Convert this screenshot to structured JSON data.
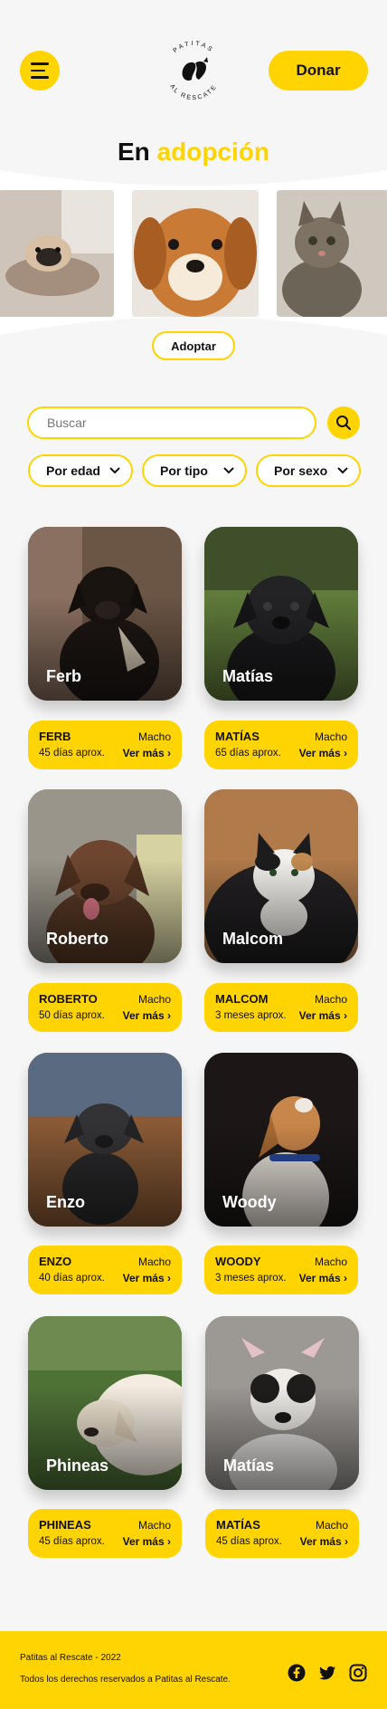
{
  "header": {
    "brand_top": "PATITAS",
    "brand_bottom": "AL RESCATE",
    "donate_label": "Donar"
  },
  "hero": {
    "title_plain": "En",
    "title_accent": "adopción",
    "adopt_label": "Adoptar"
  },
  "search": {
    "placeholder": "Buscar"
  },
  "filters": [
    {
      "label": "Por edad"
    },
    {
      "label": "Por tipo"
    },
    {
      "label": "Por sexo"
    }
  ],
  "pets": [
    {
      "photo_name": "Ferb",
      "name": "FERB",
      "sex": "Macho",
      "age": "45 días aprox.",
      "more": "Ver más"
    },
    {
      "photo_name": "Matías",
      "name": "MATÍAS",
      "sex": "Macho",
      "age": "65 días aprox.",
      "more": "Ver más"
    },
    {
      "photo_name": "Roberto",
      "name": "ROBERTO",
      "sex": "Macho",
      "age": "50 días aprox.",
      "more": "Ver más"
    },
    {
      "photo_name": "Malcom",
      "name": "MALCOM",
      "sex": "Macho",
      "age": "3 meses aprox.",
      "more": "Ver más"
    },
    {
      "photo_name": "Enzo",
      "name": "ENZO",
      "sex": "Macho",
      "age": "40 días aprox.",
      "more": "Ver más"
    },
    {
      "photo_name": "Woody",
      "name": "WOODY",
      "sex": "Macho",
      "age": "3 meses aprox.",
      "more": "Ver más"
    },
    {
      "photo_name": "Phineas",
      "name": "PHINEAS",
      "sex": "Macho",
      "age": "45 días aprox.",
      "more": "Ver más"
    },
    {
      "photo_name": "Matías",
      "name": "MATÍAS",
      "sex": "Macho",
      "age": "45 días aprox.",
      "more": "Ver más"
    }
  ],
  "footer": {
    "copyright": "Patitas al Rescate - 2022",
    "rights": "Todos los derechos reservados a Patitas al Rescate."
  },
  "colors": {
    "accent": "#FFD400",
    "background": "#f6f6f6"
  },
  "icons": [
    "menu-icon",
    "search-icon",
    "chevron-down-icon",
    "chevron-right-icon",
    "facebook-icon",
    "twitter-icon",
    "instagram-icon"
  ]
}
